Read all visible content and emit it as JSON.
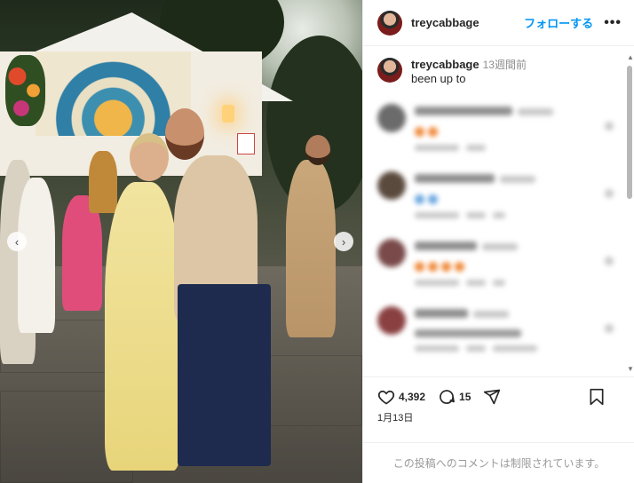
{
  "post": {
    "username": "treycabbage",
    "follow_label": "フォローする",
    "more_label": "•••",
    "caption": {
      "username": "treycabbage",
      "time": "13週間前",
      "text": "been up to"
    },
    "likes": "4,392",
    "comments_count": "15",
    "date": "1月13日",
    "comments_restricted": "この投稿へのコメントは制限されています。"
  },
  "photo": {
    "prev_label": "‹",
    "next_label": "›"
  },
  "icons": {
    "more": "more-options-icon",
    "heart": "heart-icon",
    "comment": "comment-icon",
    "share": "share-icon",
    "save": "bookmark-icon"
  },
  "colors": {
    "accent": "#0095f6",
    "text": "#262626",
    "muted": "#8e8e8e"
  }
}
